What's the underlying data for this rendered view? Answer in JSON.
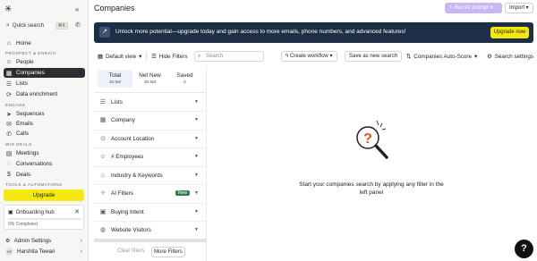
{
  "sidebar": {
    "search_label": "Quick search",
    "search_shortcut": "⌘K",
    "items_top": [
      {
        "label": "Home",
        "icon": "home-icon"
      },
      {
        "label": "People",
        "icon": "person-icon"
      },
      {
        "label": "Companies",
        "icon": "building-icon"
      },
      {
        "label": "Lists",
        "icon": "list-icon"
      },
      {
        "label": "Data enrichment",
        "icon": "enrich-icon"
      },
      {
        "label": "Sequences",
        "icon": "send-icon"
      },
      {
        "label": "Emails",
        "icon": "mail-icon"
      },
      {
        "label": "Calls",
        "icon": "phone-icon"
      },
      {
        "label": "Meetings",
        "icon": "calendar-icon"
      },
      {
        "label": "Conversations",
        "icon": "chat-icon"
      },
      {
        "label": "Deals",
        "icon": "dollar-icon"
      }
    ],
    "sections": {
      "prospect": "PROSPECT & ENRICH",
      "engage": "ENGAGE",
      "win": "WIN DEALS",
      "tools": "TOOLS & AUTOMATIONS"
    },
    "upgrade_label": "Upgrade",
    "onboarding": {
      "title": "Onboarding hub",
      "progress": "0% Completed",
      "progress_value": 0
    },
    "admin_label": "Admin Settings",
    "user": {
      "name": "Harshita Tewari",
      "initials": "HT"
    }
  },
  "header": {
    "title": "Companies",
    "ai_button": "Run AI prompt",
    "import_button": "Import"
  },
  "banner": {
    "text": "Unlock more potential—upgrade today and gain access to more emails, phone numbers, and advanced features!",
    "button": "Upgrade now"
  },
  "toolbar": {
    "view": "Default view",
    "hide_filters": "Hide Filters",
    "search_placeholder": "Search",
    "create_workflow": "Create workflow",
    "save_search": "Save as new search",
    "auto_score": "Companies Auto-Score",
    "search_settings": "Search settings"
  },
  "counts": [
    {
      "label": "Total",
      "value": "30.5M"
    },
    {
      "label": "Net New",
      "value": "30.5M"
    },
    {
      "label": "Saved",
      "value": "0"
    }
  ],
  "filters": [
    {
      "label": "Lists",
      "icon": "list-icon"
    },
    {
      "label": "Company",
      "icon": "building-icon"
    },
    {
      "label": "Account Location",
      "icon": "location-icon"
    },
    {
      "label": "# Employees",
      "icon": "people-icon"
    },
    {
      "label": "Industry & Keywords",
      "icon": "industry-icon"
    },
    {
      "label": "AI Filters",
      "icon": "sparkle-icon",
      "badge": "New"
    },
    {
      "label": "Buying Intent",
      "icon": "intent-icon"
    },
    {
      "label": "Website Visitors",
      "icon": "globe-icon"
    }
  ],
  "filter_actions": {
    "clear": "Clear filters",
    "more": "More Filters"
  },
  "empty_state": {
    "text": "Start your companies search by applying any filter in the left panel"
  },
  "help_label": "?"
}
